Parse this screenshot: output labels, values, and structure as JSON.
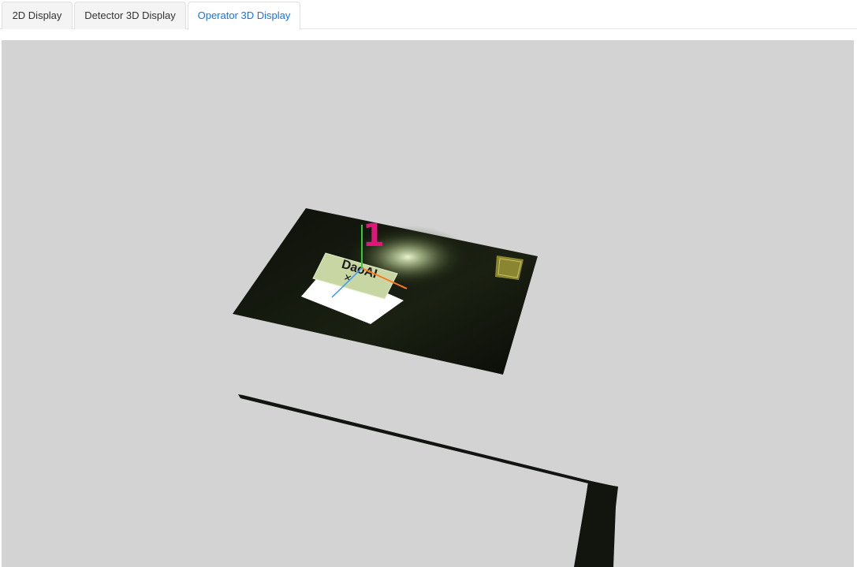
{
  "tabs": [
    {
      "label": "2D Display",
      "active": false
    },
    {
      "label": "Detector 3D Display",
      "active": false
    },
    {
      "label": "Operator 3D Display",
      "active": true
    }
  ],
  "viewport": {
    "background": "#d3d3d3",
    "object_text": "DaoAI",
    "marker_index": "1",
    "marker_color": "#e0177a",
    "axis_colors": {
      "x": "#ff7a1a",
      "y": "#33cc33",
      "z": "#3399ff"
    }
  },
  "colors": {
    "active_tab_text": "#1a73e8",
    "inactive_tab_text": "#333333"
  }
}
